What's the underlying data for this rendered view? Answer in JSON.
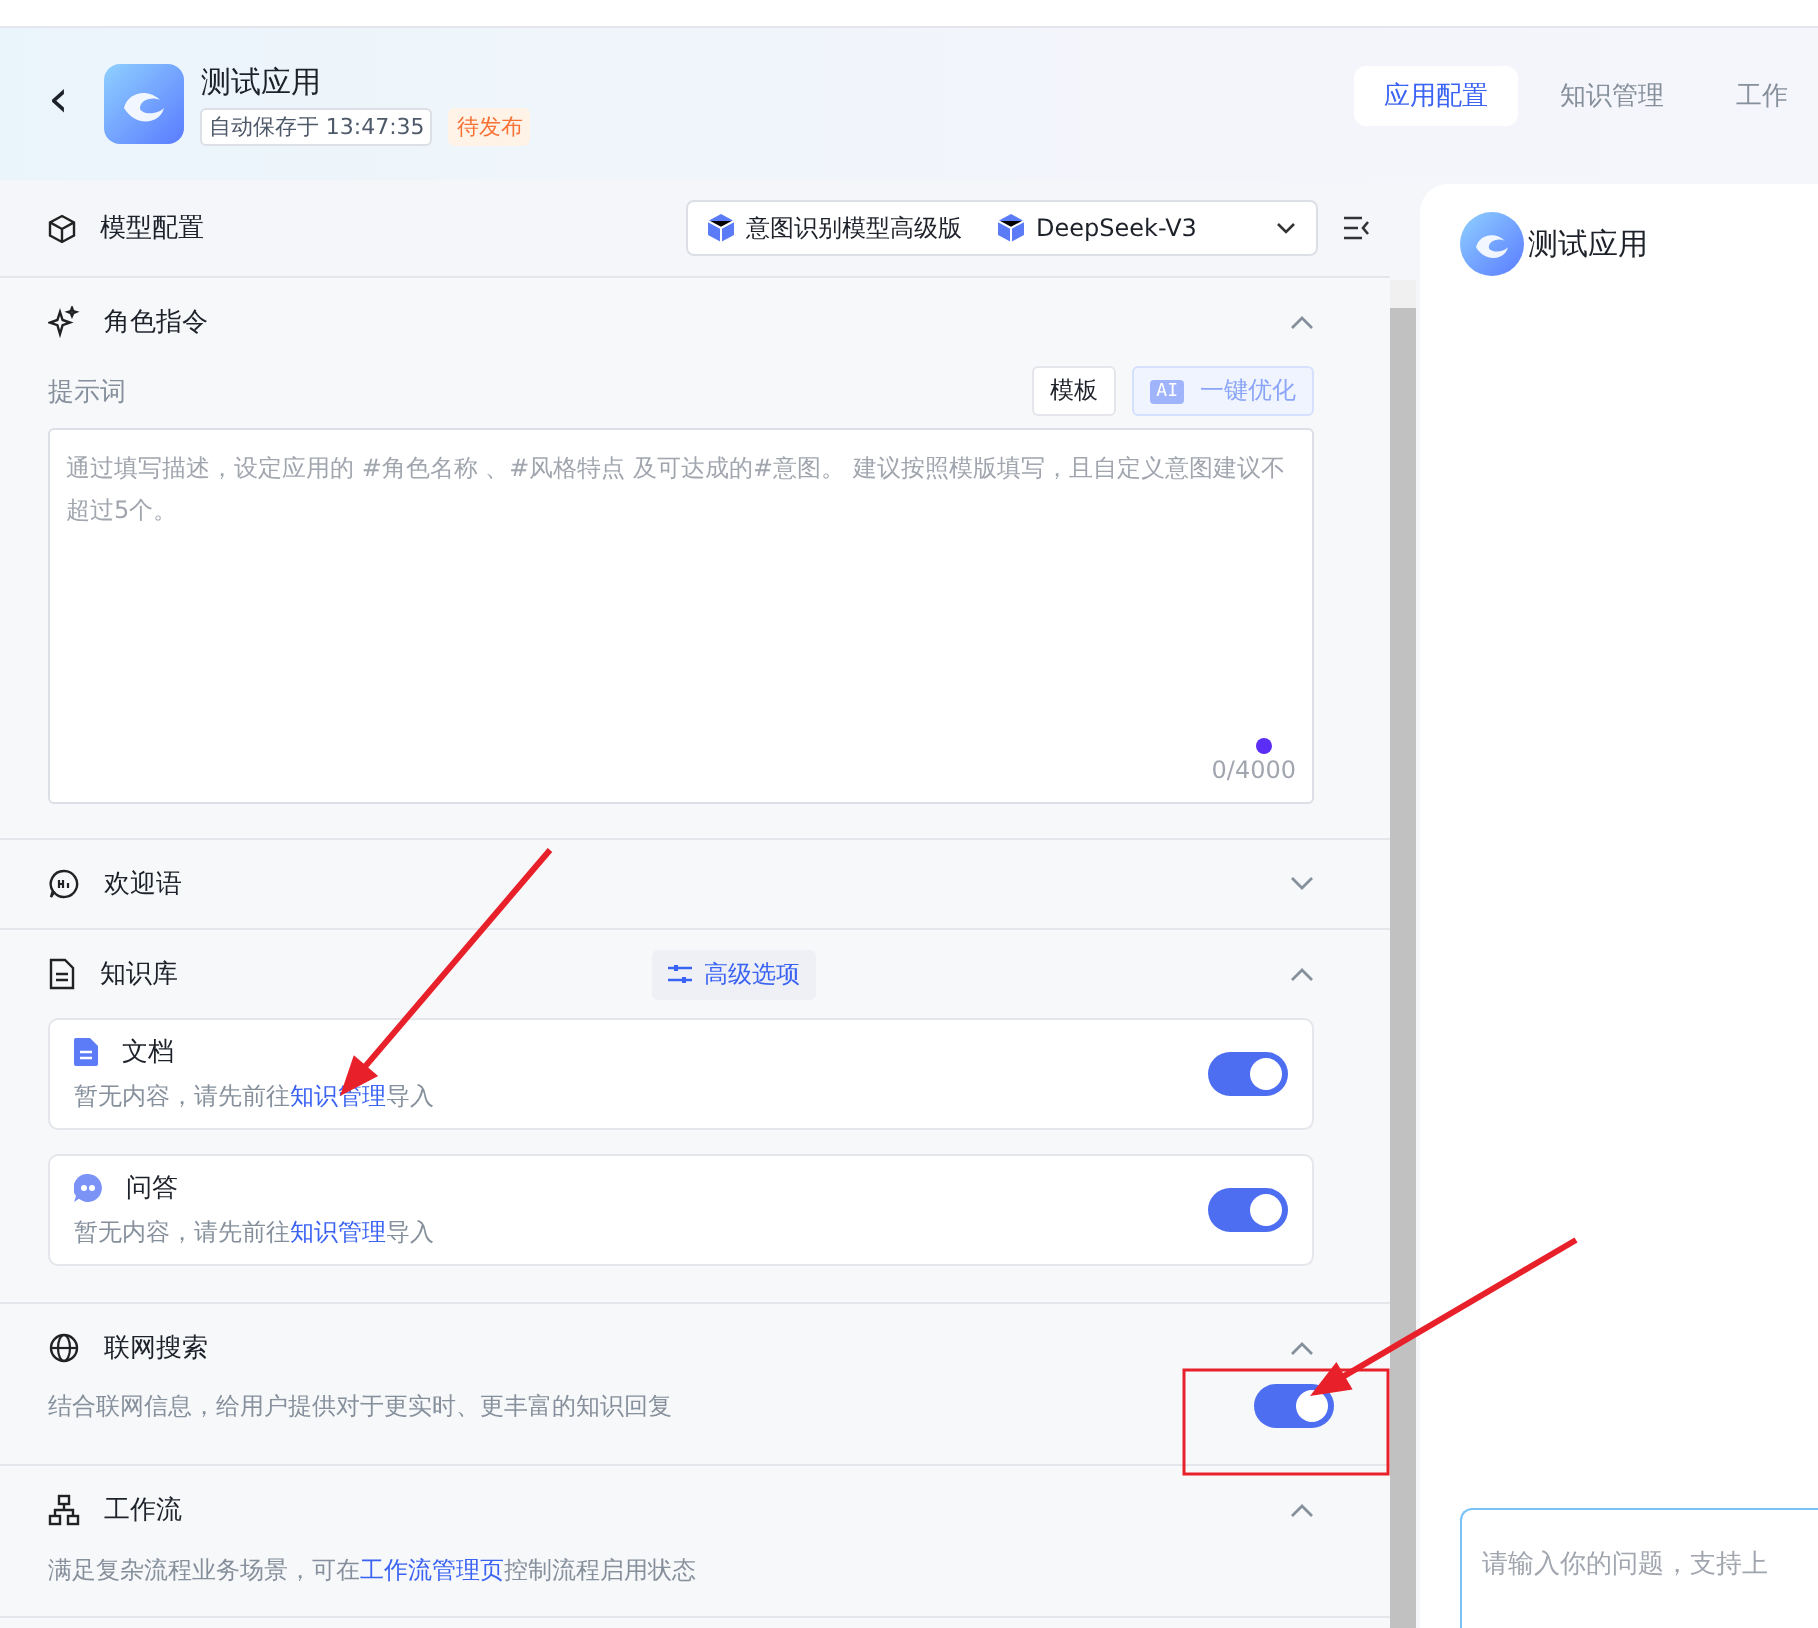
{
  "header": {
    "back": "‹",
    "app_name": "测试应用",
    "autosave": "自动保存于 13:47:35",
    "status": "待发布"
  },
  "tabs": [
    {
      "label": "应用配置",
      "selected": true
    },
    {
      "label": "知识管理",
      "selected": false
    },
    {
      "label": "工作",
      "selected": false
    }
  ],
  "model_config": {
    "title": "模型配置",
    "models": [
      "意图识别模型高级版",
      "DeepSeek-V3"
    ]
  },
  "sections": [
    {
      "kind": "prompt",
      "title": "角色指令",
      "expanded": true,
      "label": "提示词",
      "template_button": "模板",
      "ai_badge": "AI",
      "optimize_button": "一键优化",
      "placeholder": "通过填写描述，设定应用的 #角色名称 、#风格特点 及可达成的#意图。 建议按照模版填写，且自定义意图建议不超过5个。",
      "counter": "0/4000"
    },
    {
      "kind": "welcome",
      "title": "欢迎语",
      "expanded": false
    },
    {
      "kind": "knowledge",
      "title": "知识库",
      "expanded": true,
      "advanced_button": "高级选项",
      "items": [
        {
          "kind": "doc",
          "title": "文档",
          "desc_before": "暂无内容，请先前往",
          "link": "知识管理",
          "desc_after": "导入",
          "on": true
        },
        {
          "kind": "qa",
          "title": "问答",
          "desc_before": "暂无内容，请先前往",
          "link": "知识管理",
          "desc_after": "导入",
          "on": true
        }
      ]
    },
    {
      "kind": "web",
      "title": "联网搜索",
      "expanded": true,
      "desc_before": "结合联网信息，给用户提供对于更实时、更丰富的知识回复",
      "on": true
    },
    {
      "kind": "workflow",
      "title": "工作流",
      "expanded": true,
      "desc_before": "满足复杂流程业务场景，可在",
      "link": "工作流管理页",
      "desc_after": "控制流程启用状态"
    }
  ],
  "preview": {
    "app_name": "测试应用",
    "input_placeholder": "请输入你的问题，支持上"
  },
  "annotations": [
    {
      "kind": "arrow"
    },
    {
      "kind": "arrow"
    },
    {
      "kind": "box"
    }
  ]
}
